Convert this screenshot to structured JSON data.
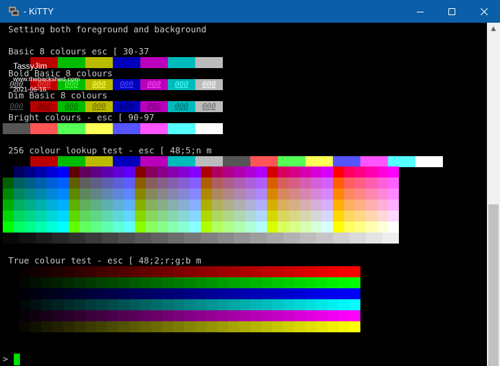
{
  "window": {
    "title": "- KiTTY"
  },
  "terminal": {
    "line_header": "Setting both foreground and background",
    "line_basic": "Basic 8 colours esc [ 30-37",
    "line_bold": "Bold Basic 8 colours",
    "line_dim": "Dim Basic 8 colours",
    "line_bright": "Bright colours - esc [ 90-97",
    "line_256": "256 colour lookup test - esc [ 48;5;n m",
    "line_true": "True colour test - esc [ 48;2;r;g;b m",
    "prompt": ">",
    "cell_text": "000"
  },
  "watermark": {
    "name": "TassyJim",
    "site": "www.thebackshed.com",
    "date": "2021-06-16"
  },
  "colors": {
    "basic": [
      "#000000",
      "#bb0000",
      "#00bb00",
      "#bbbb00",
      "#0000bb",
      "#bb00bb",
      "#00bbbb",
      "#bbbbbb"
    ],
    "bright": [
      "#555555",
      "#ff5555",
      "#55ff55",
      "#ffff55",
      "#5555ff",
      "#ff55ff",
      "#55ffff",
      "#ffffff"
    ],
    "dim": [
      "#000000",
      "#bb0000",
      "#00bb00",
      "#bbbb00",
      "#0000bb",
      "#bb00bb",
      "#00bbbb",
      "#bbbbbb"
    ],
    "bold_fg": [
      "#bbbbbb",
      "#ff5555",
      "#55ff55",
      "#ffff55",
      "#5555ff",
      "#ff55ff",
      "#55ffff",
      "#ffffff"
    ],
    "dim_fg": [
      "#555555",
      "#660000",
      "#006600",
      "#666600",
      "#000066",
      "#660066",
      "#006666",
      "#666666"
    ],
    "accent_titlebar": "#0a5fa8",
    "cursor": "#00e000"
  }
}
